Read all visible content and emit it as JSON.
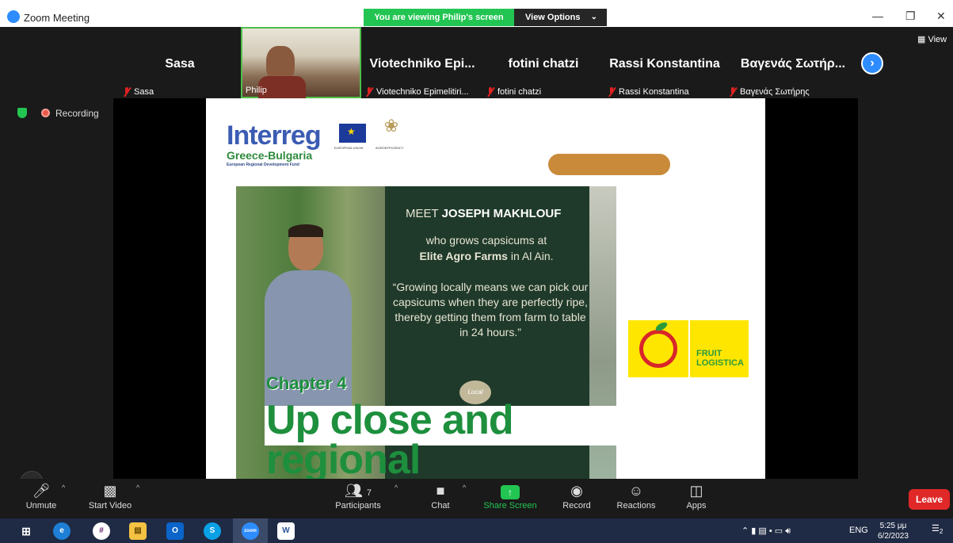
{
  "window": {
    "title": "Zoom Meeting"
  },
  "share_banner": {
    "viewing": "You are viewing Philip's screen",
    "view_options": "View Options"
  },
  "view_button": "View",
  "participants_strip": [
    {
      "name": "Sasa",
      "footer": "Sasa",
      "muted": true
    },
    {
      "name": "",
      "footer": "Philip",
      "muted": false,
      "active": true
    },
    {
      "name": "Viotechniko Epi...",
      "footer": "Viotechniko Epimelitiri...",
      "muted": true
    },
    {
      "name": "fotini chatzi",
      "footer": "fotini chatzi",
      "muted": true
    },
    {
      "name": "Rassi Konstantina",
      "footer": "Rassi Konstantina",
      "muted": true
    },
    {
      "name": "Βαγενάς Σωτήρ...",
      "footer": "Βαγενάς Σωτήρης",
      "muted": true
    }
  ],
  "recording": {
    "label": "Recording"
  },
  "slide": {
    "interreg": "Interreg",
    "program": "Greece-Bulgaria",
    "fund": "European Regional Development Fund",
    "eu_label": "EUROPEAN UNION",
    "agro_label": "AGROEFFICIENCY",
    "poster": {
      "meet_prefix": "MEET",
      "meet_name": "JOSEPH MAKHLOUF",
      "who_line1": "who grows capsicums at",
      "who_bold": "Elite Agro Farms",
      "who_line2_rest": "in Al Ain.",
      "quote": "“Growing locally means we can pick our capsicums when they are perfectly ripe, thereby getting them from farm to table in 24 hours.”",
      "local_badge": "Local",
      "chapter": "Chapter 4",
      "headline1": "Up close and",
      "headline2": "regional"
    },
    "logo_text": "FRUIT LOGISTICA",
    "colors": {
      "interreg_blue": "#3b5cb3",
      "green": "#1d8f3d",
      "pill": "#c98a3a",
      "logo_yellow": "#ffe600"
    }
  },
  "toolbar": {
    "unmute": "Unmute",
    "start_video": "Start Video",
    "participants": "Participants",
    "participants_count": "7",
    "chat": "Chat",
    "share_screen": "Share Screen",
    "record": "Record",
    "reactions": "Reactions",
    "apps": "Apps",
    "leave": "Leave"
  },
  "taskbar": {
    "apps": [
      "windows-start",
      "edge",
      "slack",
      "file-explorer",
      "outlook",
      "skype",
      "zoom",
      "word"
    ],
    "lang": "ENG",
    "time": "5:25 μμ",
    "date": "6/2/2023",
    "notifications": "2"
  },
  "accent_colors": {
    "zoom_blue": "#2d8cff",
    "green": "#23c552",
    "leave_red": "#e02828"
  }
}
